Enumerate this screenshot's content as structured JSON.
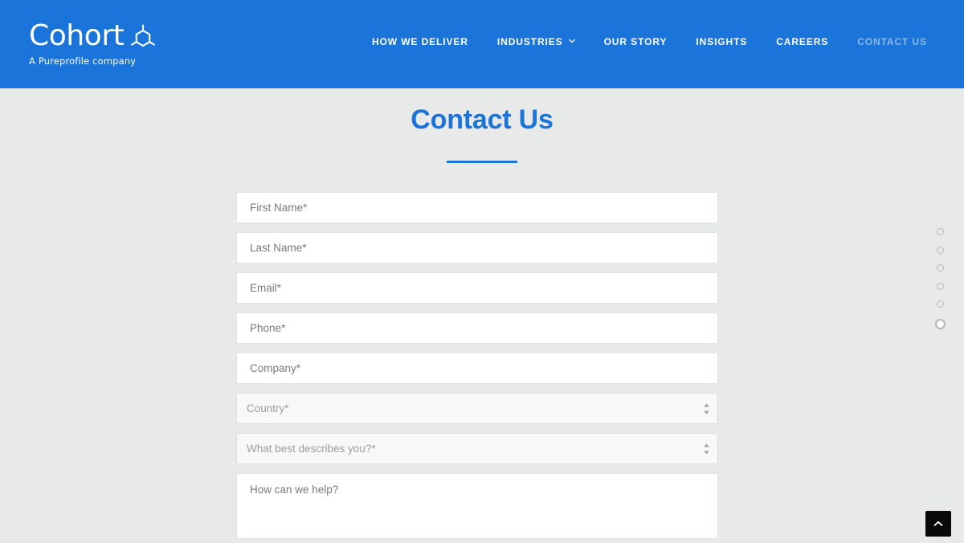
{
  "header": {
    "brand_name": "Cohort",
    "brand_tagline": "A Pureprofile company",
    "logo_icon": "hexagon-molecule-icon",
    "background_color": "#1b74d9",
    "nav": [
      {
        "label": "HOW WE DELIVER",
        "active": false,
        "has_caret": false
      },
      {
        "label": "INDUSTRIES",
        "active": false,
        "has_caret": true,
        "caret_icon": "chevron-down-icon"
      },
      {
        "label": "OUR STORY",
        "active": false,
        "has_caret": false
      },
      {
        "label": "INSIGHTS",
        "active": false,
        "has_caret": false
      },
      {
        "label": "CAREERS",
        "active": false,
        "has_caret": false
      },
      {
        "label": "CONTACT US",
        "active": true,
        "has_caret": false
      }
    ]
  },
  "page": {
    "title": "Contact Us",
    "accent_color": "#1b74d9",
    "background_color": "#e8e9e9"
  },
  "form": {
    "fields": [
      {
        "name": "first-name",
        "type": "text",
        "placeholder": "First Name*",
        "value": ""
      },
      {
        "name": "last-name",
        "type": "text",
        "placeholder": "Last Name*",
        "value": ""
      },
      {
        "name": "email",
        "type": "text",
        "placeholder": "Email*",
        "value": ""
      },
      {
        "name": "phone",
        "type": "text",
        "placeholder": "Phone*",
        "value": ""
      },
      {
        "name": "company",
        "type": "text",
        "placeholder": "Company*",
        "value": ""
      },
      {
        "name": "country",
        "type": "select",
        "placeholder": "Country*",
        "value": "Country*",
        "icon": "spinner-arrows-icon"
      },
      {
        "name": "describes-you",
        "type": "select",
        "placeholder": "What best describes you?*",
        "value": "What best describes you?*",
        "icon": "spinner-arrows-icon"
      },
      {
        "name": "message",
        "type": "textarea",
        "placeholder": "How can we help?",
        "value": ""
      }
    ]
  },
  "section_dots": {
    "count": 6,
    "active_index": 5,
    "color": "#b6b8b8"
  },
  "scroll_top": {
    "icon": "chevron-up-icon",
    "background_color": "#0a0a0a"
  }
}
